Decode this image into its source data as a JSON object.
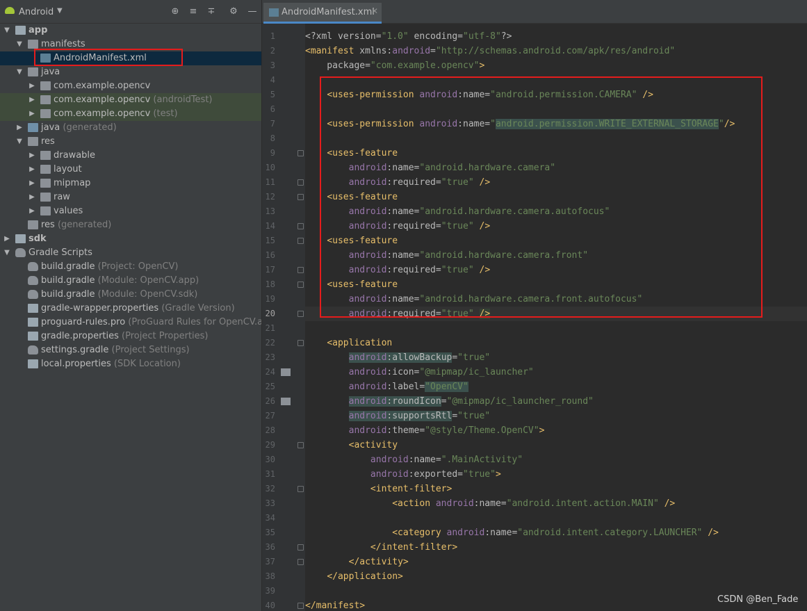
{
  "project_panel": {
    "title": "Android",
    "tree": [
      {
        "depth": 0,
        "arrow": "down",
        "icon": "module",
        "label": "app",
        "bold": true
      },
      {
        "depth": 1,
        "arrow": "down",
        "icon": "folder",
        "label": "manifests"
      },
      {
        "depth": 2,
        "arrow": "",
        "icon": "xml",
        "label": "AndroidManifest.xml",
        "selected": true
      },
      {
        "depth": 1,
        "arrow": "down",
        "icon": "folder",
        "label": "java"
      },
      {
        "depth": 2,
        "arrow": "right",
        "icon": "package",
        "label": "com.example.opencv"
      },
      {
        "depth": 2,
        "arrow": "right",
        "icon": "package",
        "label": "com.example.opencv",
        "secondary": "(androidTest)",
        "test": true
      },
      {
        "depth": 2,
        "arrow": "right",
        "icon": "package",
        "label": "com.example.opencv",
        "secondary": "(test)",
        "test": true
      },
      {
        "depth": 1,
        "arrow": "right",
        "icon": "folder-blue",
        "label": "java",
        "secondary": "(generated)"
      },
      {
        "depth": 1,
        "arrow": "down",
        "icon": "folder",
        "label": "res"
      },
      {
        "depth": 2,
        "arrow": "right",
        "icon": "folder",
        "label": "drawable"
      },
      {
        "depth": 2,
        "arrow": "right",
        "icon": "folder",
        "label": "layout"
      },
      {
        "depth": 2,
        "arrow": "right",
        "icon": "folder",
        "label": "mipmap"
      },
      {
        "depth": 2,
        "arrow": "right",
        "icon": "folder",
        "label": "raw"
      },
      {
        "depth": 2,
        "arrow": "right",
        "icon": "folder",
        "label": "values"
      },
      {
        "depth": 1,
        "arrow": "",
        "icon": "folder",
        "label": "res",
        "secondary": "(generated)"
      },
      {
        "depth": 0,
        "arrow": "right",
        "icon": "module",
        "label": "sdk",
        "bold": true
      },
      {
        "depth": 0,
        "arrow": "down",
        "icon": "gradle",
        "label": "Gradle Scripts"
      },
      {
        "depth": 1,
        "arrow": "",
        "icon": "gradle",
        "label": "build.gradle",
        "secondary": "(Project: OpenCV)"
      },
      {
        "depth": 1,
        "arrow": "",
        "icon": "gradle",
        "label": "build.gradle",
        "secondary": "(Module: OpenCV.app)"
      },
      {
        "depth": 1,
        "arrow": "",
        "icon": "gradle",
        "label": "build.gradle",
        "secondary": "(Module: OpenCV.sdk)"
      },
      {
        "depth": 1,
        "arrow": "",
        "icon": "props",
        "label": "gradle-wrapper.properties",
        "secondary": "(Gradle Version)"
      },
      {
        "depth": 1,
        "arrow": "",
        "icon": "props",
        "label": "proguard-rules.pro",
        "secondary": "(ProGuard Rules for OpenCV.app)"
      },
      {
        "depth": 1,
        "arrow": "",
        "icon": "props",
        "label": "gradle.properties",
        "secondary": "(Project Properties)"
      },
      {
        "depth": 1,
        "arrow": "",
        "icon": "gradle",
        "label": "settings.gradle",
        "secondary": "(Project Settings)"
      },
      {
        "depth": 1,
        "arrow": "",
        "icon": "props",
        "label": "local.properties",
        "secondary": "(SDK Location)"
      }
    ]
  },
  "editor": {
    "tab_label": "AndroidManifest.xml",
    "current_line": 20,
    "lines": [
      [
        [
          "a",
          "<?xml version="
        ],
        [
          "s",
          "\"1.0\""
        ],
        [
          "a",
          " encoding="
        ],
        [
          "s",
          "\"utf-8\""
        ],
        [
          "a",
          "?>"
        ]
      ],
      [
        [
          "t",
          "<manifest "
        ],
        [
          "a",
          "xmlns:"
        ],
        [
          "ns",
          "android"
        ],
        [
          "a",
          "="
        ],
        [
          "s",
          "\"http://schemas.android.com/apk/res/android\""
        ]
      ],
      [
        [
          "a",
          "    package="
        ],
        [
          "s",
          "\"com.example.opencv\""
        ],
        [
          "t",
          ">"
        ]
      ],
      [],
      [
        [
          "a",
          "    "
        ],
        [
          "t",
          "<uses-permission "
        ],
        [
          "ns",
          "android"
        ],
        [
          "a",
          ":name="
        ],
        [
          "s",
          "\"android.permission.CAMERA\""
        ],
        [
          "t",
          " />"
        ]
      ],
      [],
      [
        [
          "a",
          "    "
        ],
        [
          "t",
          "<uses-permission "
        ],
        [
          "ns",
          "android"
        ],
        [
          "a",
          ":name="
        ],
        [
          "s",
          "\""
        ],
        [
          "hl",
          "android.permission.WRITE_EXTERNAL_STORAGE"
        ],
        [
          "s",
          "\""
        ],
        [
          "t",
          "/>"
        ]
      ],
      [],
      [
        [
          "a",
          "    "
        ],
        [
          "t",
          "<uses-feature"
        ]
      ],
      [
        [
          "a",
          "        "
        ],
        [
          "ns",
          "android"
        ],
        [
          "a",
          ":name="
        ],
        [
          "s",
          "\"android.hardware.camera\""
        ]
      ],
      [
        [
          "a",
          "        "
        ],
        [
          "ns",
          "android"
        ],
        [
          "a",
          ":required="
        ],
        [
          "s",
          "\"true\""
        ],
        [
          "t",
          " />"
        ]
      ],
      [
        [
          "a",
          "    "
        ],
        [
          "t",
          "<uses-feature"
        ]
      ],
      [
        [
          "a",
          "        "
        ],
        [
          "ns",
          "android"
        ],
        [
          "a",
          ":name="
        ],
        [
          "s",
          "\"android.hardware.camera.autofocus\""
        ]
      ],
      [
        [
          "a",
          "        "
        ],
        [
          "ns",
          "android"
        ],
        [
          "a",
          ":required="
        ],
        [
          "s",
          "\"true\""
        ],
        [
          "t",
          " />"
        ]
      ],
      [
        [
          "a",
          "    "
        ],
        [
          "t",
          "<uses-feature"
        ]
      ],
      [
        [
          "a",
          "        "
        ],
        [
          "ns",
          "android"
        ],
        [
          "a",
          ":name="
        ],
        [
          "s",
          "\"android.hardware.camera.front\""
        ]
      ],
      [
        [
          "a",
          "        "
        ],
        [
          "ns",
          "android"
        ],
        [
          "a",
          ":required="
        ],
        [
          "s",
          "\"true\""
        ],
        [
          "t",
          " />"
        ]
      ],
      [
        [
          "a",
          "    "
        ],
        [
          "t",
          "<uses-feature"
        ]
      ],
      [
        [
          "a",
          "        "
        ],
        [
          "ns",
          "android"
        ],
        [
          "a",
          ":name="
        ],
        [
          "s",
          "\"android.hardware.camera.front.autofocus\""
        ]
      ],
      [
        [
          "a",
          "        "
        ],
        [
          "ns",
          "android"
        ],
        [
          "a",
          ":required="
        ],
        [
          "s",
          "\"true\""
        ],
        [
          "t",
          " "
        ],
        [
          "hl2",
          "/>"
        ]
      ],
      [],
      [
        [
          "a",
          "    "
        ],
        [
          "t",
          "<application"
        ]
      ],
      [
        [
          "a",
          "        "
        ],
        [
          "hlns",
          "android"
        ],
        [
          "hla",
          ":allowBackup"
        ],
        [
          "a",
          "="
        ],
        [
          "s",
          "\"true\""
        ]
      ],
      [
        [
          "a",
          "        "
        ],
        [
          "ns",
          "android"
        ],
        [
          "a",
          ":icon="
        ],
        [
          "s",
          "\"@mipmap/ic_launcher\""
        ]
      ],
      [
        [
          "a",
          "        "
        ],
        [
          "ns",
          "android"
        ],
        [
          "a",
          ":label="
        ],
        [
          "hls",
          "\"OpenCV\""
        ]
      ],
      [
        [
          "a",
          "        "
        ],
        [
          "hlns",
          "android"
        ],
        [
          "hla",
          ":roundIcon"
        ],
        [
          "a",
          "="
        ],
        [
          "s",
          "\"@mipmap/ic_launcher_round\""
        ]
      ],
      [
        [
          "a",
          "        "
        ],
        [
          "hlns",
          "android"
        ],
        [
          "hla",
          ":supportsRtl"
        ],
        [
          "a",
          "="
        ],
        [
          "s",
          "\"true\""
        ]
      ],
      [
        [
          "a",
          "        "
        ],
        [
          "ns",
          "android"
        ],
        [
          "a",
          ":theme="
        ],
        [
          "s",
          "\"@style/Theme.OpenCV\""
        ],
        [
          "t",
          ">"
        ]
      ],
      [
        [
          "a",
          "        "
        ],
        [
          "t",
          "<activity"
        ]
      ],
      [
        [
          "a",
          "            "
        ],
        [
          "ns",
          "android"
        ],
        [
          "a",
          ":name="
        ],
        [
          "s",
          "\".MainActivity\""
        ]
      ],
      [
        [
          "a",
          "            "
        ],
        [
          "ns",
          "android"
        ],
        [
          "a",
          ":exported="
        ],
        [
          "s",
          "\"true\""
        ],
        [
          "t",
          ">"
        ]
      ],
      [
        [
          "a",
          "            "
        ],
        [
          "t",
          "<intent-filter>"
        ]
      ],
      [
        [
          "a",
          "                "
        ],
        [
          "t",
          "<action "
        ],
        [
          "ns",
          "android"
        ],
        [
          "a",
          ":name="
        ],
        [
          "s",
          "\"android.intent.action.MAIN\""
        ],
        [
          "t",
          " />"
        ]
      ],
      [],
      [
        [
          "a",
          "                "
        ],
        [
          "t",
          "<category "
        ],
        [
          "ns",
          "android"
        ],
        [
          "a",
          ":name="
        ],
        [
          "s",
          "\"android.intent.category.LAUNCHER\""
        ],
        [
          "t",
          " />"
        ]
      ],
      [
        [
          "a",
          "            "
        ],
        [
          "t",
          "</intent-filter>"
        ]
      ],
      [
        [
          "a",
          "        "
        ],
        [
          "t",
          "</activity>"
        ]
      ],
      [
        [
          "a",
          "    "
        ],
        [
          "t",
          "</application>"
        ]
      ],
      [],
      [
        [
          "t",
          "</manifest>"
        ]
      ]
    ]
  },
  "watermark": "CSDN @Ben_Fade"
}
